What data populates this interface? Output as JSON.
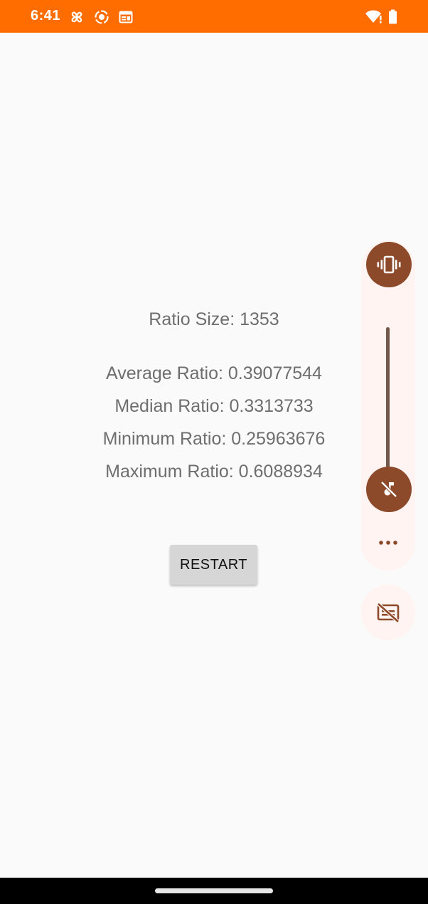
{
  "status_bar": {
    "time": "6:41",
    "background_color": "#ff6d00",
    "left_icons": [
      "pinwheel-icon",
      "record-icon",
      "calendar-icon"
    ],
    "right_icons": [
      "wifi-alert-icon",
      "battery-icon"
    ]
  },
  "stats": {
    "ratio_size": "Ratio Size: 1353",
    "average_ratio": "Average Ratio: 0.39077544",
    "median_ratio": "Median Ratio: 0.3313733",
    "minimum_ratio": "Minimum Ratio: 0.25963676",
    "maximum_ratio": "Maximum Ratio: 0.6088934"
  },
  "restart_button": {
    "label": "RESTART"
  },
  "volume_panel": {
    "ringer_mode_icon": "vibrate-icon",
    "media_mute_icon": "music-off-icon",
    "more_icon": "more-horiz-icon",
    "captions_icon": "captions-off-icon",
    "accent_color": "#8c4a2b",
    "level": 0
  }
}
